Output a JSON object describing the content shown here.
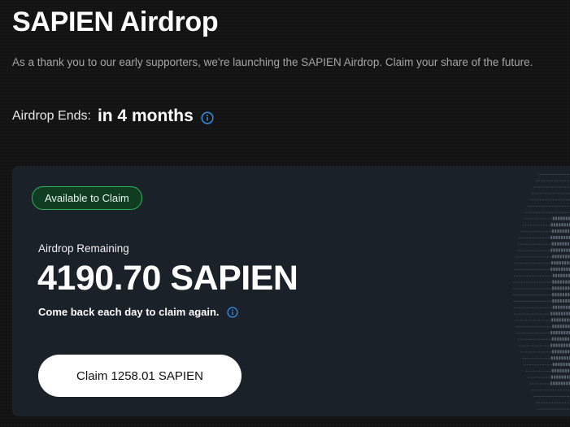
{
  "page": {
    "title": "SAPIEN Airdrop",
    "subtitle": "As a thank you to our early supporters, we're launching the SAPIEN Airdrop. Claim your share of the future.",
    "airdrop_ends_label": "Airdrop Ends:",
    "airdrop_ends_value": "in 4 months"
  },
  "card": {
    "status_badge": "Available to Claim",
    "remaining_label": "Airdrop Remaining",
    "remaining_value": "4190.70 SAPIEN",
    "comeback_text": "Come back each day to claim again.",
    "claim_button_label": "Claim 1258.01 SAPIEN"
  },
  "icons": {
    "ends_info": "info-icon",
    "comeback_info": "info-icon"
  },
  "colors": {
    "accent_blue": "#2f8fe8",
    "badge_green": "#2fb35a",
    "card_bg": "#1b2128"
  }
}
